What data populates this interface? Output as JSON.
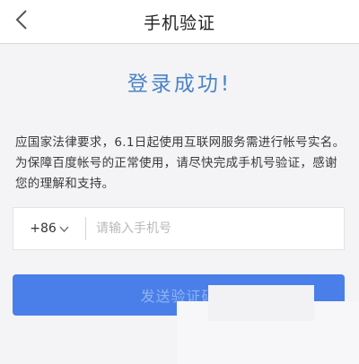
{
  "navbar": {
    "title": "手机验证",
    "back_icon": "chevron-left-icon"
  },
  "success_message": "登录成功!",
  "notice_text": "应国家法律要求，6.1日起使用互联网服务需进行帐号实名。为保障百度帐号的正常使用，请尽快完成手机号验证，感谢您的理解和支持。",
  "phone": {
    "country_code": "+86",
    "dropdown_icon": "chevron-down-icon",
    "placeholder": "请输入手机号",
    "value": ""
  },
  "send_button": {
    "label": "发送验证码"
  },
  "colors": {
    "accent": "#4a83c8",
    "button": "#4a7fe9",
    "background": "#f4f4f6"
  }
}
